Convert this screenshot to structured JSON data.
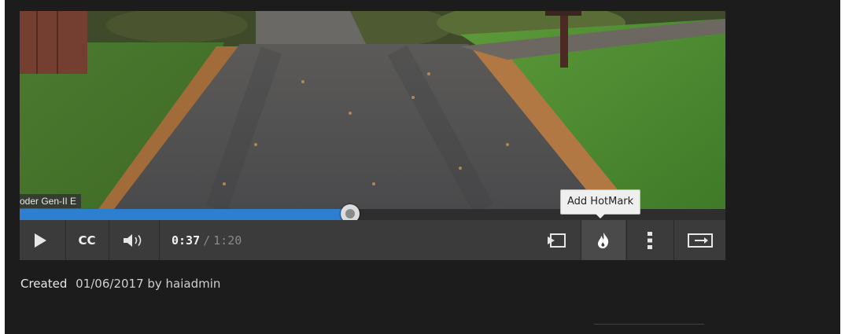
{
  "player": {
    "subtitle_overlay": "oder Gen-II E",
    "progress_fraction": 0.468,
    "time_current": "0:37",
    "time_separator": "/",
    "time_duration": "1:20",
    "cc_label": "CC",
    "tooltip": "Add HotMark"
  },
  "meta": {
    "created_label": "Created",
    "created_value": "01/06/2017 by haiadmin"
  },
  "icons": [
    "play-icon",
    "cc-icon",
    "volume-icon",
    "cast-icon",
    "hotmark-flame-icon",
    "more-vertical-icon",
    "fullscreen-exit-icon"
  ],
  "colors": {
    "progress": "#2f7fd0",
    "controls_bg": "#3b3b3b",
    "page_bg": "#1c1c1c"
  }
}
